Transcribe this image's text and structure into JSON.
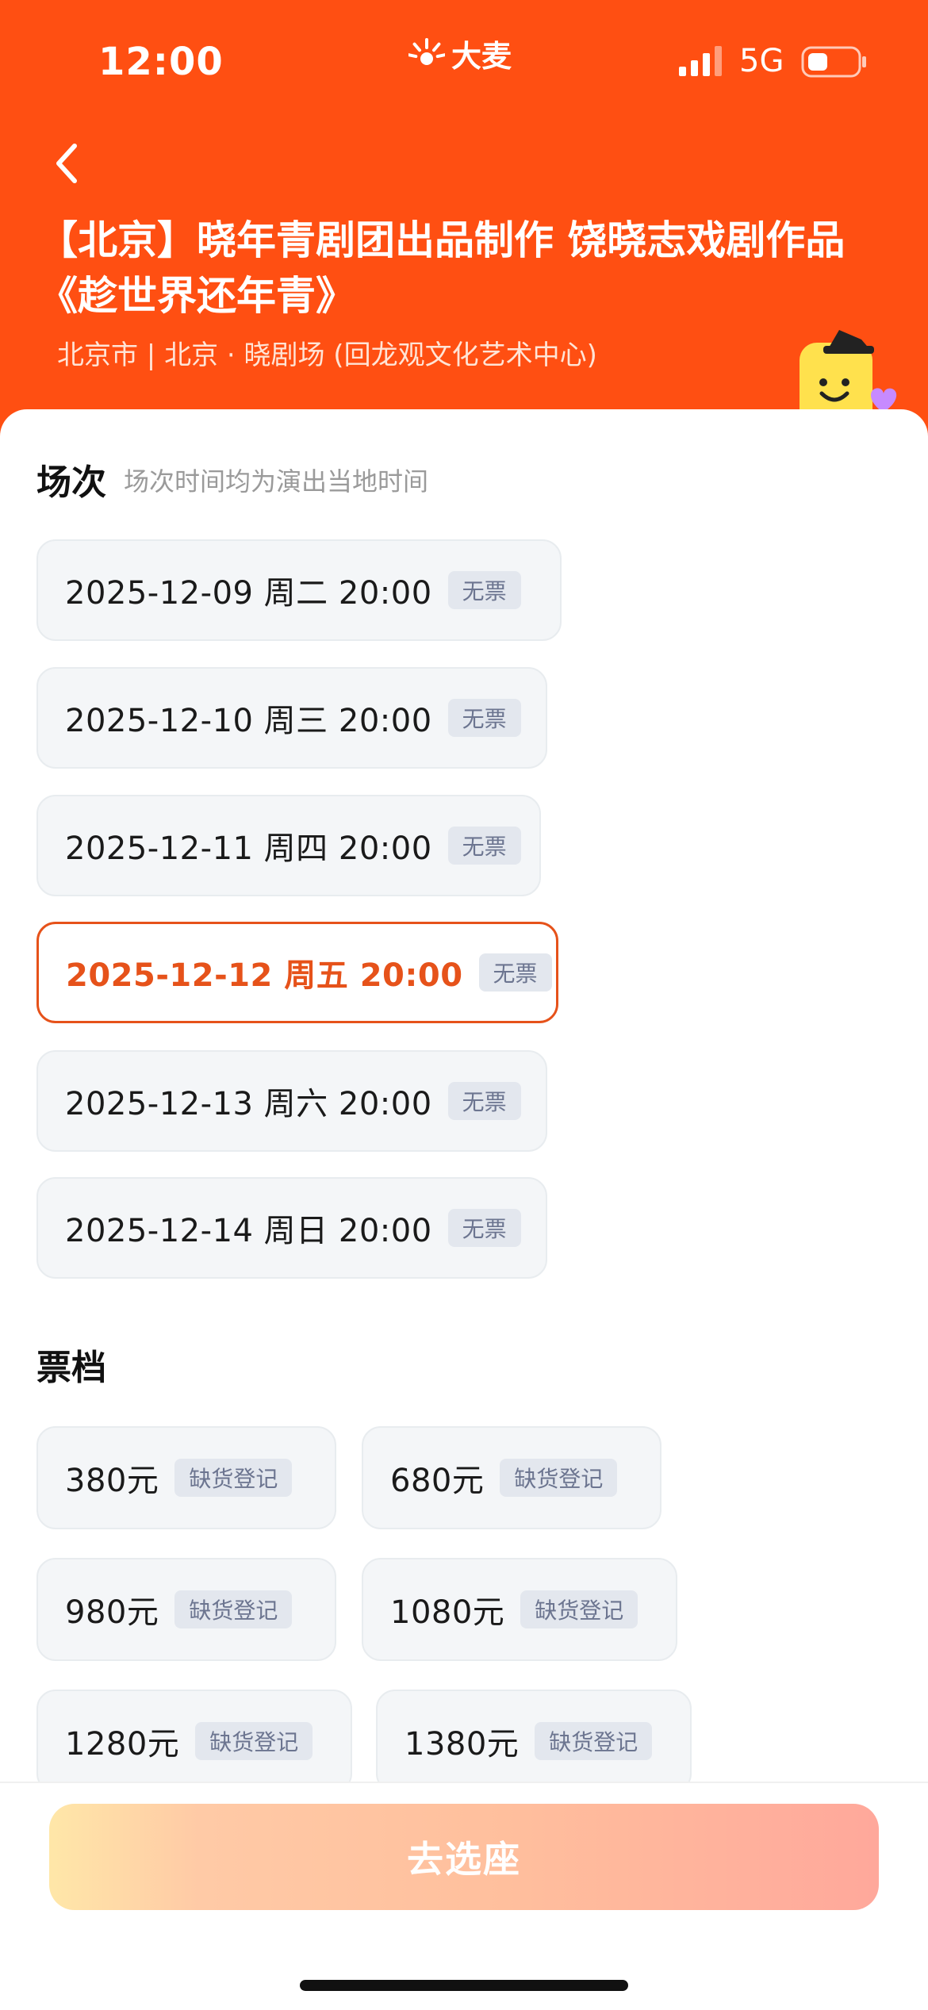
{
  "status_bar": {
    "time": "12:00",
    "brand": "大麦",
    "network": "5G"
  },
  "header": {
    "title": "【北京】晓年青剧团出品制作 饶晓志戏剧作品《趁世界还年青》",
    "venue": "北京市 | 北京 · 晓剧场 (回龙观文化艺术中心)"
  },
  "sessions": {
    "title": "场次",
    "note": "场次时间均为演出当地时间",
    "items": [
      {
        "label": "2025-12-09  周二 20:00",
        "tag": "无票",
        "selected": false
      },
      {
        "label": "2025-12-10 周三 20:00",
        "tag": "无票",
        "selected": false
      },
      {
        "label": "2025-12-11 周四 20:00",
        "tag": "无票",
        "selected": false
      },
      {
        "label": "2025-12-12 周五 20:00",
        "tag": "无票",
        "selected": true
      },
      {
        "label": "2025-12-13 周六 20:00",
        "tag": "无票",
        "selected": false
      },
      {
        "label": "2025-12-14 周日 20:00",
        "tag": "无票",
        "selected": false
      }
    ]
  },
  "tiers": {
    "title": "票档",
    "items": [
      {
        "price": "380元",
        "tag": "缺货登记"
      },
      {
        "price": "680元",
        "tag": "缺货登记"
      },
      {
        "price": "980元",
        "tag": "缺货登记"
      },
      {
        "price": "1080元",
        "tag": "缺货登记"
      },
      {
        "price": "1280元",
        "tag": "缺货登记"
      },
      {
        "price": "1380元",
        "tag": "缺货登记"
      }
    ]
  },
  "cta": {
    "label": "去选座"
  },
  "colors": {
    "header_bg": "#ff4f12",
    "accent": "#e6521a",
    "chip_bg": "#f4f6f8",
    "tag_bg": "#e3e7ee",
    "tag_text": "#6c7590"
  },
  "icons": {
    "back": "chevron-left-icon",
    "brand": "damai-logo-icon",
    "signal": "cellular-signal-icon",
    "battery": "battery-icon",
    "mascot": "mascot-sticker-icon"
  }
}
